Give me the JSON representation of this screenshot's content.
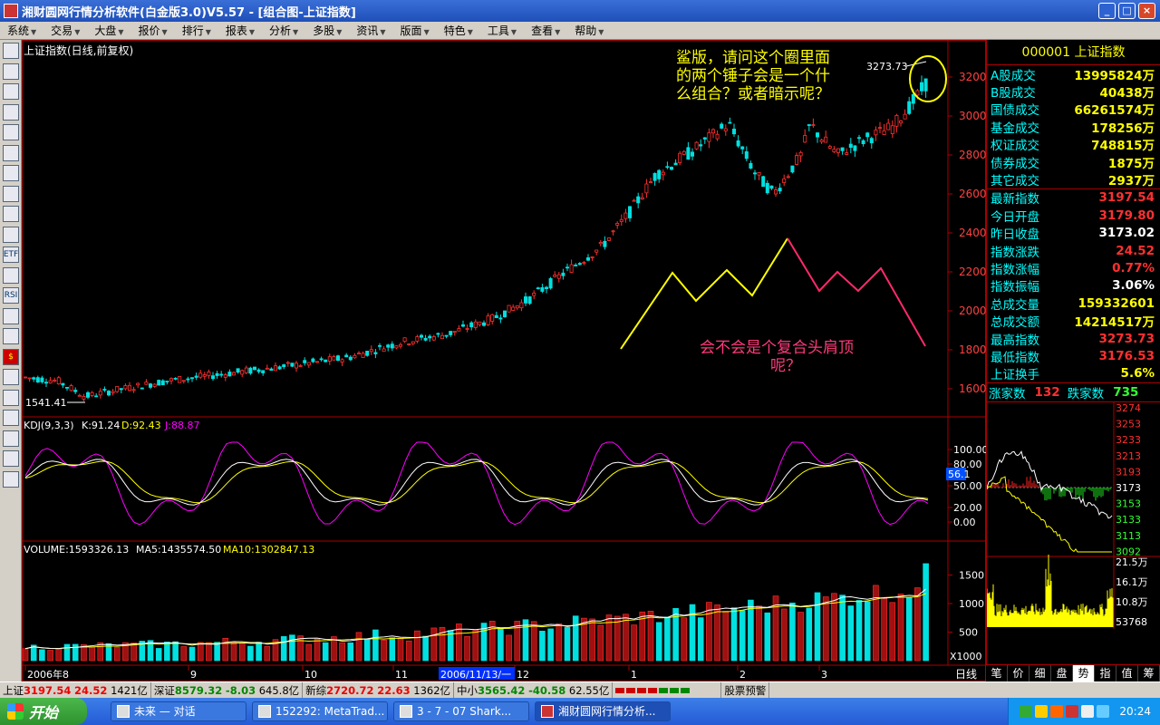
{
  "window": {
    "title": "湘财圆网行情分析软件(白金版3.0)V5.57 - [组合图-上证指数]",
    "buttons": [
      "_",
      "□",
      "×"
    ]
  },
  "menu": [
    {
      "label": "系统"
    },
    {
      "label": "交易"
    },
    {
      "label": "大盘"
    },
    {
      "label": "报价"
    },
    {
      "label": "排行"
    },
    {
      "label": "报表"
    },
    {
      "label": "分析"
    },
    {
      "label": "多股"
    },
    {
      "label": "资讯"
    },
    {
      "label": "版面"
    },
    {
      "label": "特色"
    },
    {
      "label": "工具"
    },
    {
      "label": "查看"
    },
    {
      "label": "帮助"
    }
  ],
  "toolbar_icons": [
    "quote-icon",
    "grid-icon",
    "line-chart-icon",
    "candle-icon",
    "report-icon",
    "table-icon",
    "mail-icon",
    "people-icon",
    "f10-icon",
    "magnify-icon",
    "etf-icon",
    "wave-icon",
    "rsi-icon",
    "list-icon",
    "multi-icon",
    "dollar-icon",
    "link-icon",
    "exit-icon",
    "pencil-icon",
    "move-icon",
    "arrow-up-icon",
    "arrow-down-icon"
  ],
  "toolbar_labels": [
    "",
    "",
    "",
    "",
    "",
    "",
    "",
    "",
    "",
    "",
    "ETF",
    "",
    "RSI",
    "",
    "",
    "$",
    "",
    "",
    "",
    "",
    "",
    ""
  ],
  "chart": {
    "title": "上证指数(日线,前复权)",
    "high_label": "3273.73",
    "low_label": "1541.41",
    "y_ticks": [
      "3200",
      "3000",
      "2800",
      "2600",
      "2400",
      "2200",
      "2000",
      "1800",
      "1600"
    ],
    "annotation1": [
      "鲨版，请问这个圈里面",
      "的两个锤子会是一个什",
      "么组合？或者暗示呢？"
    ],
    "annotation2": [
      "会不会是个复合头肩顶",
      "呢？"
    ],
    "kdj_label": "KDJ(9,3,3)",
    "kdj_k": "K:91.24",
    "kdj_d": "D:92.43",
    "kdj_j": "J:88.87",
    "kdj_ticks": [
      "100.00",
      "80.00",
      "50.00",
      "20.00",
      "0.00"
    ],
    "kdj_marker": "56.1",
    "vol_label": "VOLUME:1593326.13",
    "vol_ma5": "MA5:1435574.50",
    "vol_ma10": "MA10:1302847.13",
    "vol_ticks": [
      "1500",
      "1000",
      "500"
    ],
    "vol_unit": "X1000",
    "x_labels": [
      "2006年8",
      "9",
      "10",
      "11",
      "12",
      "1",
      "2",
      "3"
    ],
    "x_highlight": "2006/11/13/一",
    "daily_tab": "日线"
  },
  "right_panel": {
    "header": "000001 上证指数",
    "group1": [
      {
        "label": "A股成交",
        "value": "13995824万",
        "color": "#ffff00"
      },
      {
        "label": "B股成交",
        "value": "40438万",
        "color": "#ffff00"
      },
      {
        "label": "国债成交",
        "value": "66261574万",
        "color": "#ffff00"
      },
      {
        "label": "基金成交",
        "value": "178256万",
        "color": "#ffff00"
      },
      {
        "label": "权证成交",
        "value": "748815万",
        "color": "#ffff00"
      },
      {
        "label": "债券成交",
        "value": "1875万",
        "color": "#ffff00"
      },
      {
        "label": "其它成交",
        "value": "2937万",
        "color": "#ffff00"
      }
    ],
    "group2": [
      {
        "label": "最新指数",
        "value": "3197.54",
        "color": "#ff3030"
      },
      {
        "label": "今日开盘",
        "value": "3179.80",
        "color": "#ff3030"
      },
      {
        "label": "昨日收盘",
        "value": "3173.02",
        "color": "#ffffff"
      },
      {
        "label": "指数涨跌",
        "value": "24.52",
        "color": "#ff3030"
      },
      {
        "label": "指数涨幅",
        "value": "0.77%",
        "color": "#ff3030"
      },
      {
        "label": "指数振幅",
        "value": "3.06%",
        "color": "#ffffff"
      },
      {
        "label": "总成交量",
        "value": "159332601",
        "color": "#ffff00"
      },
      {
        "label": "总成交额",
        "value": "14214517万",
        "color": "#ffff00"
      },
      {
        "label": "最高指数",
        "value": "3273.73",
        "color": "#ff3030"
      },
      {
        "label": "最低指数",
        "value": "3176.53",
        "color": "#ff3030"
      },
      {
        "label": "上证换手",
        "value": "5.6%",
        "color": "#ffff00"
      }
    ],
    "advance_label": "涨家数",
    "advance_value": "132",
    "decline_label": "跌家数",
    "decline_value": "735",
    "mini_price_ticks": [
      "3274",
      "3253",
      "3233",
      "3213",
      "3193",
      "3173",
      "3153",
      "3133",
      "3113",
      "3092"
    ],
    "mini_vol_ticks": [
      "21.5万",
      "16.1万",
      "10.8万",
      "53768"
    ],
    "tabs": [
      "笔",
      "价",
      "细",
      "盘",
      "势",
      "指",
      "值",
      "筹"
    ],
    "active_tab": "势"
  },
  "status": {
    "sh_label": "上证",
    "sh_value": "3197.54",
    "sh_change": "24.52",
    "sh_amount": "1421亿",
    "sz_label": "深证",
    "sz_value": "8579.32",
    "sz_change": "-8.03",
    "sz_amount": "645.8亿",
    "new_label": "新综",
    "new_value": "2720.72",
    "new_change": "22.63",
    "new_amount": "1362亿",
    "mid_label": "中小",
    "mid_value": "3565.42",
    "mid_change": "-40.58",
    "mid_amount": "62.55亿",
    "alert": "股票预警"
  },
  "taskbar": {
    "start": "开始",
    "tasks": [
      "未来 — 对话",
      "152292: MetaTrad...",
      "3 - 7 - 07 Shark...",
      "湘财圆网行情分析..."
    ],
    "clock": "20:24"
  }
}
